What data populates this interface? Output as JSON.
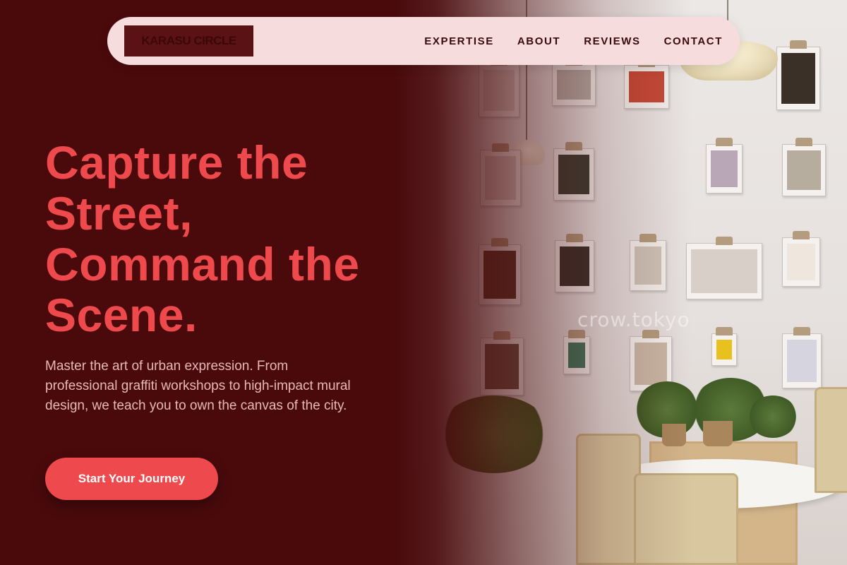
{
  "brand": {
    "name": "KARASU CIRCLE"
  },
  "nav": {
    "items": [
      {
        "label": "EXPERTISE"
      },
      {
        "label": "ABOUT"
      },
      {
        "label": "REVIEWS"
      },
      {
        "label": "CONTACT"
      }
    ]
  },
  "hero": {
    "title": "Capture the Street, Command the Scene.",
    "description": "Master the art of urban expression. From professional graffiti workshops to high-impact mural design, we teach you to own the canvas of the city.",
    "cta_label": "Start Your Journey"
  },
  "photo": {
    "watermark": "crow.tokyo"
  },
  "colors": {
    "background": "#4a0a0c",
    "accent": "#ee4a4d",
    "nav_background": "#f6dcdc",
    "body_text": "#e7b8b8"
  }
}
